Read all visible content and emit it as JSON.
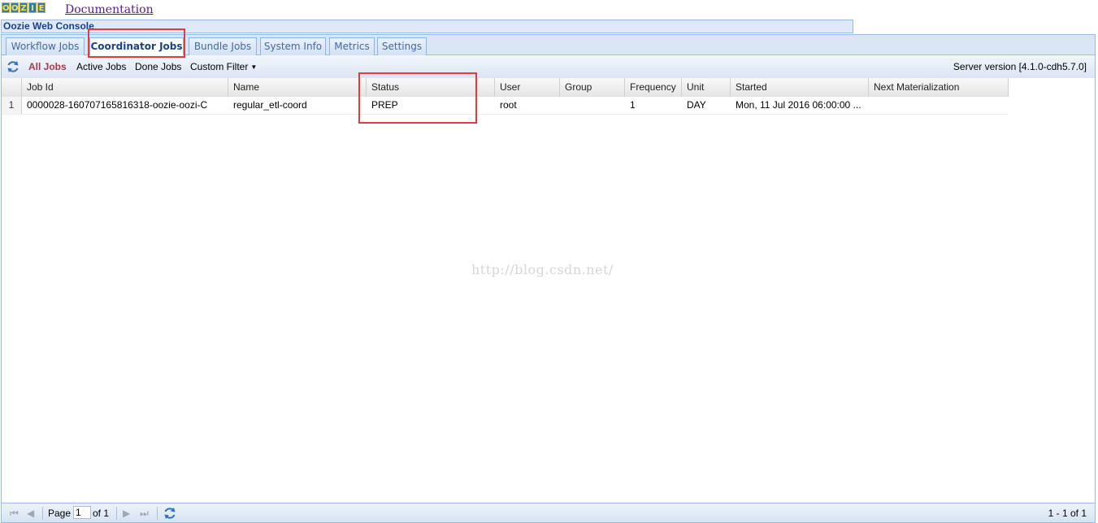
{
  "header": {
    "logo_letters": [
      "O",
      "O",
      "Z",
      "I",
      "E"
    ],
    "documentation_link": "Documentation"
  },
  "console": {
    "title": "Oozie Web Console"
  },
  "tabs": [
    {
      "label": "Workflow Jobs",
      "active": false
    },
    {
      "label": "Coordinator Jobs",
      "active": true
    },
    {
      "label": "Bundle Jobs",
      "active": false
    },
    {
      "label": "System Info",
      "active": false
    },
    {
      "label": "Metrics",
      "active": false
    },
    {
      "label": "Settings",
      "active": false
    }
  ],
  "toolbar": {
    "refresh_icon": "refresh-icon",
    "filters": [
      "All Jobs",
      "Active Jobs",
      "Done Jobs",
      "Custom Filter"
    ],
    "active_filter": "All Jobs",
    "server_version": "Server version [4.1.0-cdh5.7.0]"
  },
  "grid": {
    "columns": [
      "Job Id",
      "Name",
      "Status",
      "User",
      "Group",
      "Frequency",
      "Unit",
      "Started",
      "Next Materialization"
    ],
    "rows": [
      {
        "num": "1",
        "job_id": "0000028-160707165816318-oozie-oozi-C",
        "name": "regular_etl-coord",
        "status": "PREP",
        "user": "root",
        "group": "",
        "frequency": "1",
        "unit": "DAY",
        "started": "Mon, 11 Jul 2016 06:00:00 ...",
        "next_materialization": ""
      }
    ]
  },
  "watermark": "http://blog.csdn.net/",
  "paging": {
    "page_label": "Page",
    "page_value": "1",
    "of_label": "of 1",
    "count": "1 - 1 of 1"
  },
  "colors": {
    "highlight": "#e53b3b",
    "active_filter": "#a33d4e",
    "tab_text": "#15428b"
  }
}
